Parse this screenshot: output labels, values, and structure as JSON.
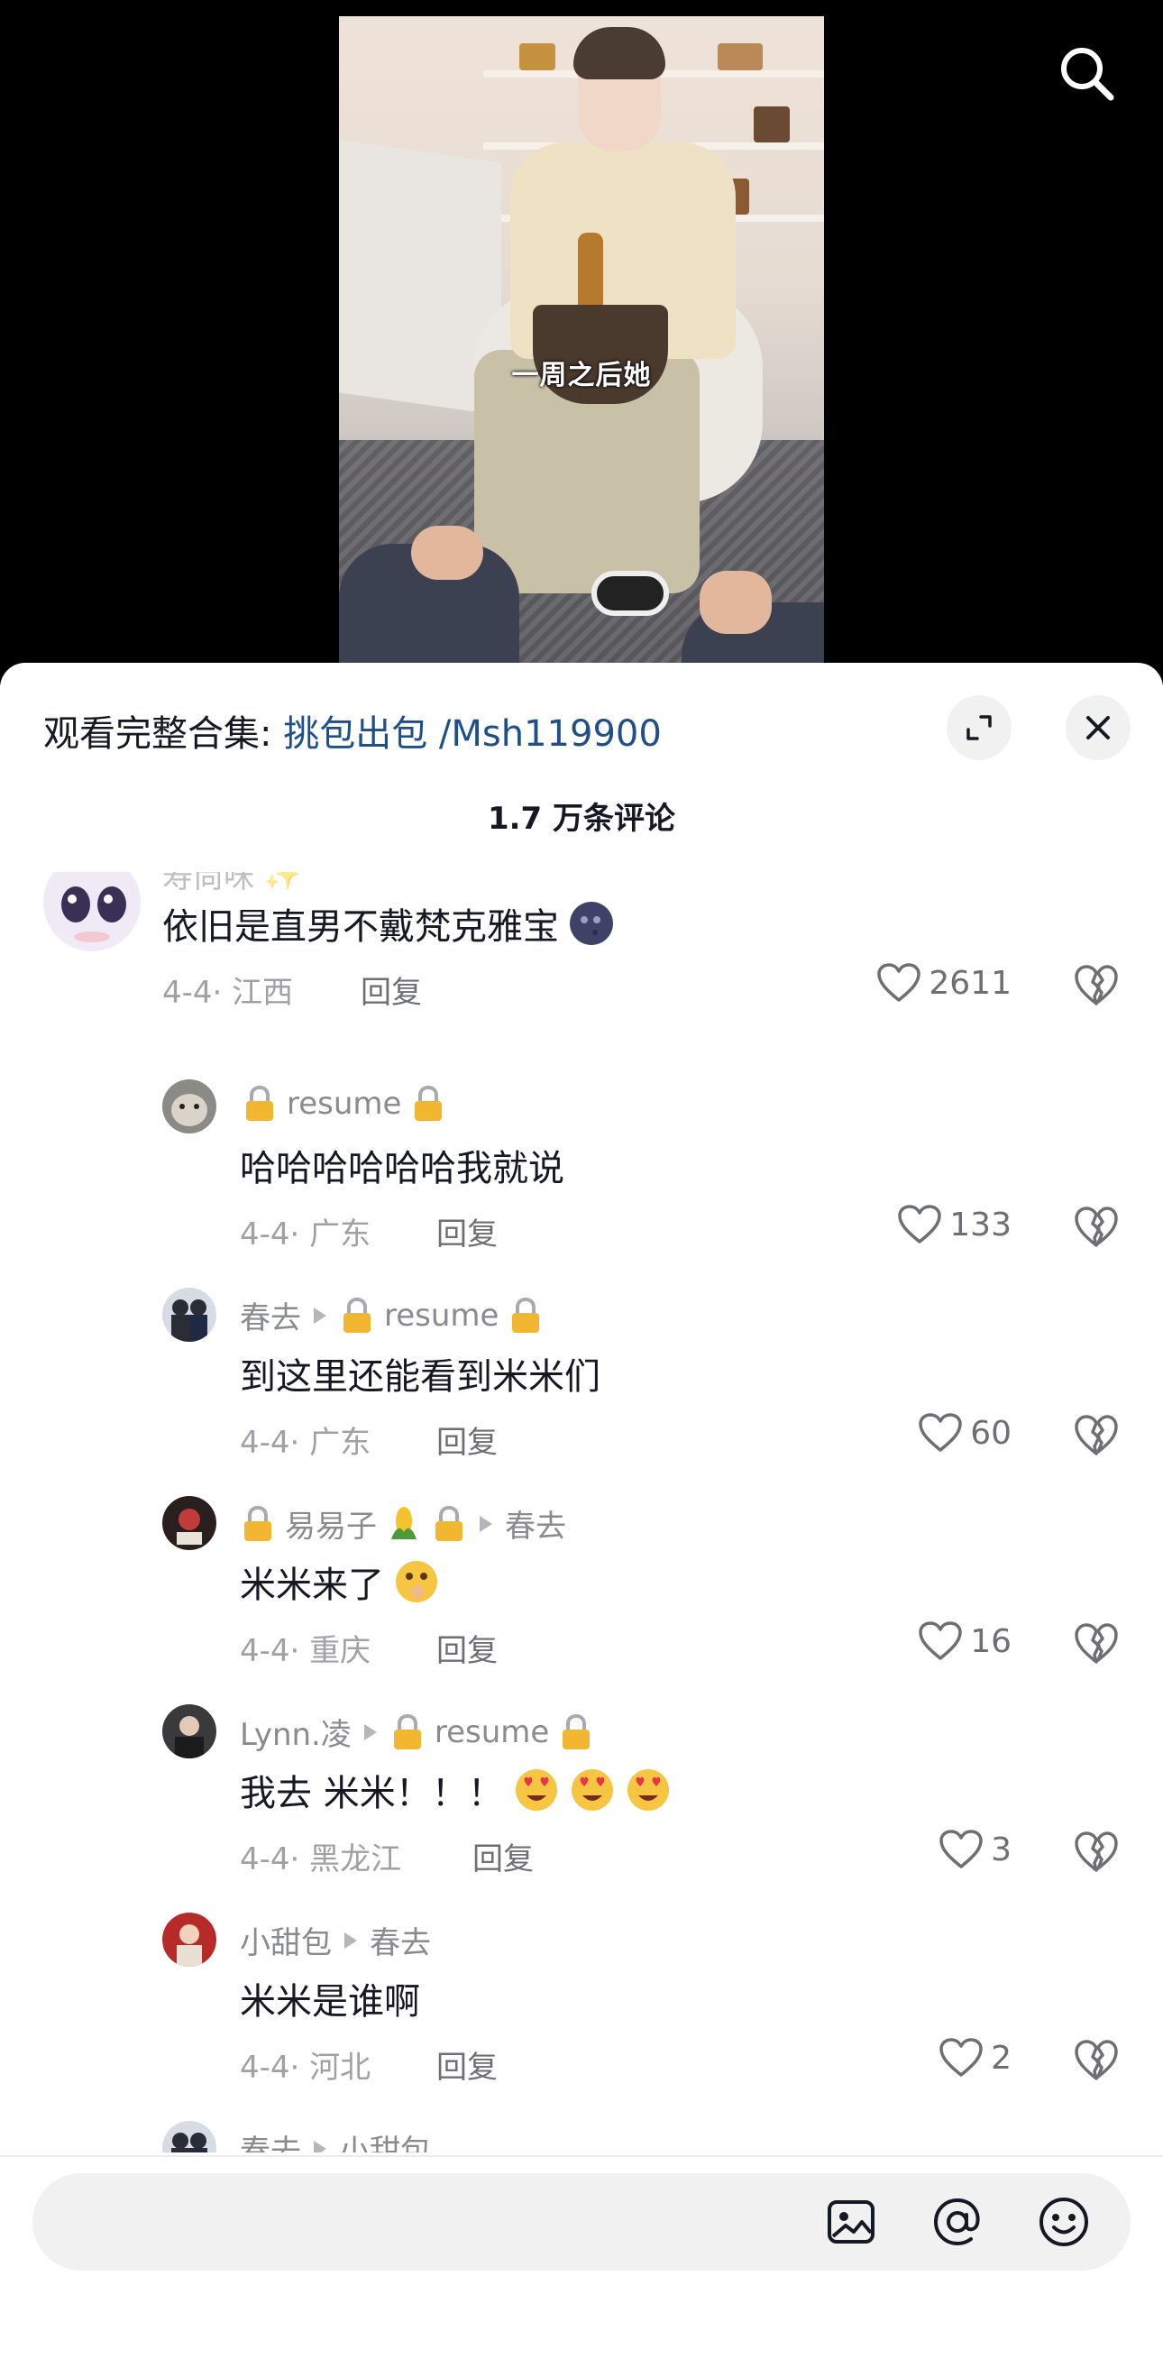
{
  "video": {
    "caption": "一周之后她"
  },
  "sheet": {
    "collection_prefix": "观看完整合集: ",
    "collection_link": "挑包出包 /Msh119900",
    "comment_count": "1.7 万条评论"
  },
  "comments": [
    {
      "name": "寿尚咪",
      "text": "依旧是直男不戴梵克雅宝",
      "date_region": "4-4· 江西",
      "reply": "回复",
      "likes": "2611"
    },
    {
      "name": "resume",
      "text": "哈哈哈哈哈哈我就说",
      "date_region": "4-4· 广东",
      "reply": "回复",
      "likes": "133"
    },
    {
      "name": "春去",
      "reply_to": "resume",
      "text": "到这里还能看到米米们",
      "date_region": "4-4· 广东",
      "reply": "回复",
      "likes": "60"
    },
    {
      "name": "易易子",
      "reply_to": "春去",
      "text": "米米来了",
      "date_region": "4-4· 重庆",
      "reply": "回复",
      "likes": "16"
    },
    {
      "name": "Lynn.凌",
      "reply_to": "resume",
      "text": "我去 米米！！！",
      "date_region": "4-4· 黑龙江",
      "reply": "回复",
      "likes": "3"
    },
    {
      "name": "小甜包",
      "reply_to": "春去",
      "text": "米米是谁啊",
      "date_region": "4-4· 河北",
      "reply": "回复",
      "likes": "2"
    },
    {
      "name": "春去",
      "reply_to": "小甜包"
    }
  ],
  "input": {
    "placeholder": ""
  },
  "icons": {
    "search": "search-icon",
    "expand": "expand-icon",
    "close": "close-icon",
    "like": "heart-icon",
    "dislike": "broken-heart-icon",
    "image": "image-icon",
    "mention": "at-icon",
    "emoji": "smiley-icon"
  },
  "colors": {
    "link": "#1e4f8a",
    "text_primary": "#161823",
    "text_secondary": "#8a8b91",
    "background_video": "#000000"
  }
}
